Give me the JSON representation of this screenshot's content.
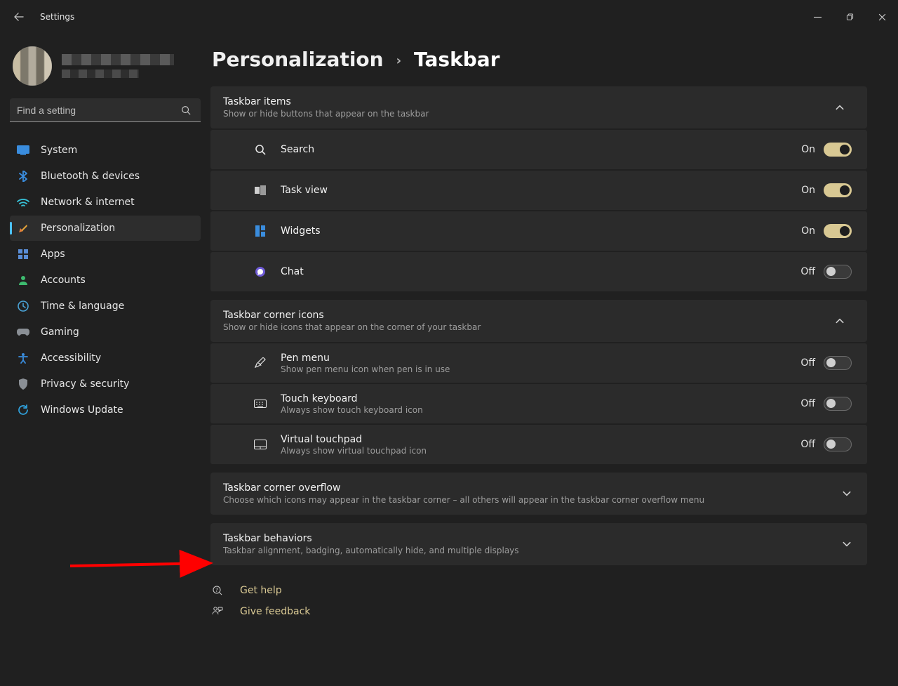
{
  "window": {
    "title": "Settings"
  },
  "search": {
    "placeholder": "Find a setting"
  },
  "sidebar": [
    {
      "key": "system",
      "label": "System"
    },
    {
      "key": "bluetooth",
      "label": "Bluetooth & devices"
    },
    {
      "key": "network",
      "label": "Network & internet"
    },
    {
      "key": "personalization",
      "label": "Personalization",
      "selected": true
    },
    {
      "key": "apps",
      "label": "Apps"
    },
    {
      "key": "accounts",
      "label": "Accounts"
    },
    {
      "key": "time",
      "label": "Time & language"
    },
    {
      "key": "gaming",
      "label": "Gaming"
    },
    {
      "key": "accessibility",
      "label": "Accessibility"
    },
    {
      "key": "privacy",
      "label": "Privacy & security"
    },
    {
      "key": "update",
      "label": "Windows Update"
    }
  ],
  "breadcrumb": {
    "parent": "Personalization",
    "current": "Taskbar"
  },
  "groups": {
    "items": {
      "title": "Taskbar items",
      "sub": "Show or hide buttons that appear on the taskbar",
      "rows": [
        {
          "key": "search",
          "label": "Search",
          "state": "On",
          "on": true
        },
        {
          "key": "taskview",
          "label": "Task view",
          "state": "On",
          "on": true
        },
        {
          "key": "widgets",
          "label": "Widgets",
          "state": "On",
          "on": true
        },
        {
          "key": "chat",
          "label": "Chat",
          "state": "Off",
          "on": false
        }
      ]
    },
    "corner": {
      "title": "Taskbar corner icons",
      "sub": "Show or hide icons that appear on the corner of your taskbar",
      "rows": [
        {
          "key": "pen",
          "label": "Pen menu",
          "sub": "Show pen menu icon when pen is in use",
          "state": "Off",
          "on": false
        },
        {
          "key": "touchkb",
          "label": "Touch keyboard",
          "sub": "Always show touch keyboard icon",
          "state": "Off",
          "on": false
        },
        {
          "key": "touchpad",
          "label": "Virtual touchpad",
          "sub": "Always show virtual touchpad icon",
          "state": "Off",
          "on": false
        }
      ]
    },
    "overflow": {
      "title": "Taskbar corner overflow",
      "sub": "Choose which icons may appear in the taskbar corner – all others will appear in the taskbar corner overflow menu"
    },
    "behaviors": {
      "title": "Taskbar behaviors",
      "sub": "Taskbar alignment, badging, automatically hide, and multiple displays"
    }
  },
  "help": {
    "get_help": "Get help",
    "give_feedback": "Give feedback"
  }
}
